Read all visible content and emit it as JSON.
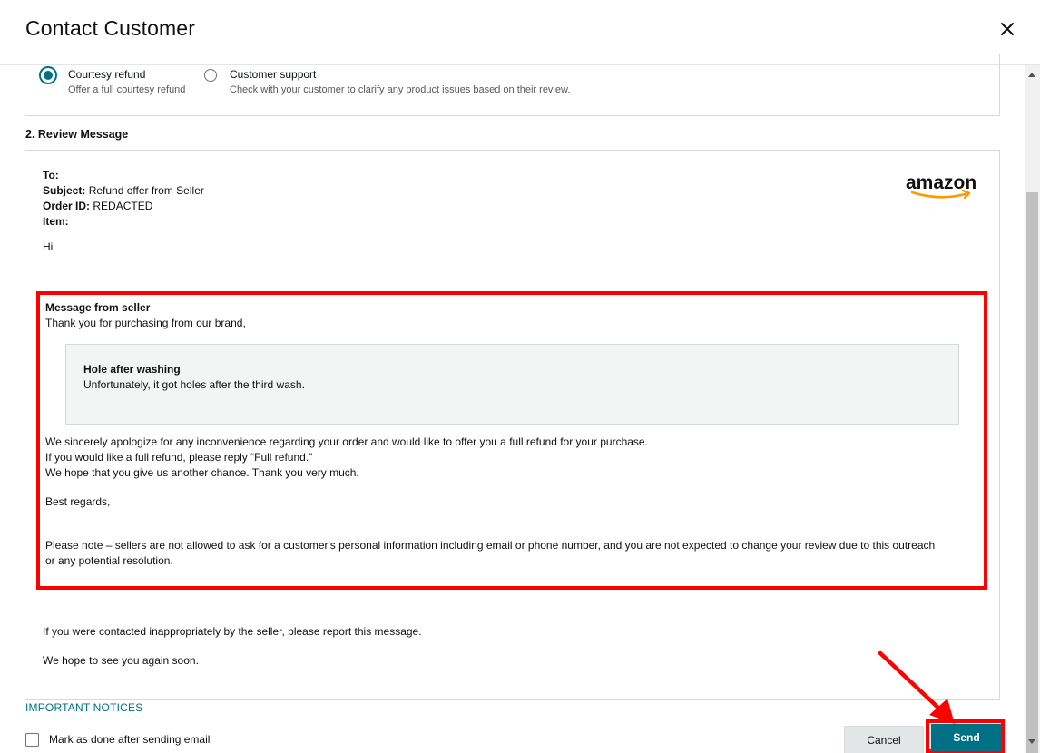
{
  "dialog": {
    "title": "Contact Customer"
  },
  "options": [
    {
      "label": "Courtesy refund",
      "description": "Offer a full courtesy refund",
      "selected": true
    },
    {
      "label": "Customer support",
      "description": "Check with your customer to clarify any product issues based on their review.",
      "selected": false
    }
  ],
  "review": {
    "section_title": "2. Review Message",
    "to_label": "To:",
    "subject_label": "Subject:",
    "subject_value": "Refund offer from Seller",
    "order_label": "Order ID:",
    "order_value": "REDACTED",
    "item_label": "Item:",
    "greeting": "Hi",
    "brand_logo_text": "amazon",
    "seller_message": {
      "heading": "Message from seller",
      "intro": "Thank you for purchasing from our brand,",
      "review_title": "Hole after washing",
      "review_text": "Unfortunately, it got holes after the third wash.",
      "line1": "We sincerely apologize for any inconvenience regarding your order and would like to offer you a full refund for your purchase.",
      "line2": "If you would like a full refund, please reply “Full refund.”",
      "line3": "We hope that you give us another chance. Thank you very much.",
      "closing": "Best regards,",
      "note_line1": "Please note – sellers are not allowed to ask for a customer's personal information including email or phone number, and you are not expected to change your review due to this outreach",
      "note_line2": "or any potential resolution."
    },
    "report_text": "If you were contacted inappropriately by the seller, please report this message.",
    "signoff": "We hope to see you again soon."
  },
  "footer": {
    "notices_link": "IMPORTANT NOTICES",
    "mark_done_label": "Mark as done after sending email",
    "cancel_label": "Cancel",
    "send_label": "Send"
  },
  "colors": {
    "accent": "#007185",
    "highlight": "#ff0000",
    "logo_smile": "#ff9900"
  },
  "icons": [
    "close-icon",
    "amazon-logo",
    "annotation-arrow"
  ]
}
